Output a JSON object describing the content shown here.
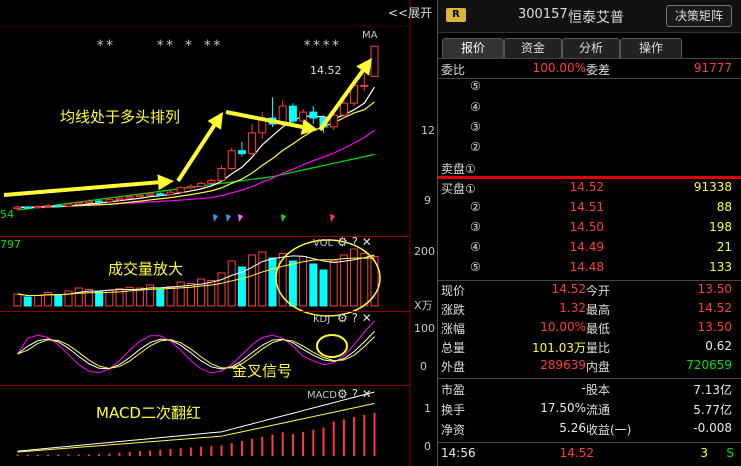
{
  "expand_button": "<<展开",
  "chart": {
    "ma_tag": "MA",
    "price_marker": "14.52",
    "stars": [
      "**",
      "** * **",
      "****"
    ],
    "y_main": [
      "12",
      "9"
    ],
    "y_vol": [
      "200",
      "X万"
    ],
    "y_kdj": [
      "100",
      "0"
    ],
    "y_macd": [
      "1",
      "0"
    ],
    "vol_tag": "VOL",
    "kdj_tag": "KDJ",
    "macd_tag": "MACD",
    "vol_left_num": "797",
    "left_num": "54",
    "annotations": {
      "ma_bull": "均线处于多头排列",
      "volume_up": "成交量放大",
      "golden_cross": "金叉信号",
      "macd_red": "MACD二次翻红"
    },
    "colors": {
      "up": "#ff3c3c",
      "down": "#00ffff",
      "ma5": "#ffffff",
      "ma10": "#ffff33",
      "ma20": "#ff00ff",
      "ma60": "#00e000",
      "arrow": "#ffff33"
    }
  },
  "chart_data": {
    "type": "candlestick",
    "candles": [
      {
        "o": 9.05,
        "c": 9.1,
        "h": 9.15,
        "l": 9.0
      },
      {
        "o": 9.1,
        "c": 9.08,
        "h": 9.14,
        "l": 9.03
      },
      {
        "o": 9.08,
        "c": 9.12,
        "h": 9.16,
        "l": 9.04
      },
      {
        "o": 9.12,
        "c": 9.15,
        "h": 9.2,
        "l": 9.08
      },
      {
        "o": 9.15,
        "c": 9.13,
        "h": 9.19,
        "l": 9.1
      },
      {
        "o": 9.13,
        "c": 9.2,
        "h": 9.24,
        "l": 9.1
      },
      {
        "o": 9.2,
        "c": 9.25,
        "h": 9.3,
        "l": 9.16
      },
      {
        "o": 9.25,
        "c": 9.3,
        "h": 9.36,
        "l": 9.22
      },
      {
        "o": 9.3,
        "c": 9.28,
        "h": 9.35,
        "l": 9.24
      },
      {
        "o": 9.28,
        "c": 9.35,
        "h": 9.4,
        "l": 9.25
      },
      {
        "o": 9.35,
        "c": 9.4,
        "h": 9.45,
        "l": 9.3
      },
      {
        "o": 9.4,
        "c": 9.45,
        "h": 9.5,
        "l": 9.36
      },
      {
        "o": 9.45,
        "c": 9.5,
        "h": 9.56,
        "l": 9.4
      },
      {
        "o": 9.5,
        "c": 9.55,
        "h": 9.62,
        "l": 9.46
      },
      {
        "o": 9.55,
        "c": 9.52,
        "h": 9.6,
        "l": 9.48
      },
      {
        "o": 9.52,
        "c": 9.6,
        "h": 9.66,
        "l": 9.5
      },
      {
        "o": 9.6,
        "c": 9.75,
        "h": 9.8,
        "l": 9.56
      },
      {
        "o": 9.75,
        "c": 9.8,
        "h": 9.88,
        "l": 9.7
      },
      {
        "o": 9.8,
        "c": 9.9,
        "h": 9.95,
        "l": 9.76
      },
      {
        "o": 9.9,
        "c": 10.0,
        "h": 10.05,
        "l": 9.86
      },
      {
        "o": 10.0,
        "c": 10.4,
        "h": 10.5,
        "l": 9.96
      },
      {
        "o": 10.4,
        "c": 11.0,
        "h": 11.1,
        "l": 10.35
      },
      {
        "o": 11.0,
        "c": 10.9,
        "h": 11.3,
        "l": 10.8
      },
      {
        "o": 10.9,
        "c": 11.6,
        "h": 11.9,
        "l": 10.85
      },
      {
        "o": 11.6,
        "c": 12.1,
        "h": 12.3,
        "l": 11.4
      },
      {
        "o": 12.1,
        "c": 11.9,
        "h": 12.8,
        "l": 11.8
      },
      {
        "o": 11.9,
        "c": 12.5,
        "h": 12.7,
        "l": 11.8
      },
      {
        "o": 12.5,
        "c": 12.0,
        "h": 12.6,
        "l": 11.9
      },
      {
        "o": 12.0,
        "c": 12.3,
        "h": 12.4,
        "l": 11.85
      },
      {
        "o": 12.3,
        "c": 12.1,
        "h": 12.5,
        "l": 11.9
      },
      {
        "o": 12.1,
        "c": 11.8,
        "h": 12.2,
        "l": 11.6
      },
      {
        "o": 11.8,
        "c": 12.2,
        "h": 12.35,
        "l": 11.7
      },
      {
        "o": 12.2,
        "c": 12.6,
        "h": 12.8,
        "l": 12.1
      },
      {
        "o": 12.6,
        "c": 13.2,
        "h": 13.4,
        "l": 12.5
      },
      {
        "o": 13.2,
        "c": 13.2,
        "h": 13.6,
        "l": 13.0
      },
      {
        "o": 13.5,
        "c": 14.52,
        "h": 14.52,
        "l": 13.5
      }
    ],
    "volume": [
      40,
      30,
      35,
      45,
      38,
      50,
      60,
      55,
      48,
      52,
      58,
      62,
      60,
      70,
      55,
      65,
      80,
      75,
      90,
      85,
      110,
      150,
      130,
      170,
      180,
      160,
      175,
      150,
      165,
      140,
      120,
      150,
      170,
      190,
      175,
      165
    ],
    "ylim_price": [
      8.8,
      15.2
    ]
  },
  "panel": {
    "badge": "R",
    "code": "300157",
    "name": "恒泰艾普",
    "decision_button": "决策矩阵",
    "tabs": [
      "报价",
      "资金",
      "分析",
      "操作"
    ],
    "weibi_label": "委比",
    "weibi_value": "100.00%",
    "weicha_label": "委差",
    "weicha_value": "91777",
    "sell_levels": [
      "⑤",
      "④",
      "③",
      "②",
      "卖盘①"
    ],
    "buy": [
      {
        "label": "买盘①",
        "price": "14.52",
        "vol": "91338"
      },
      {
        "label": "②",
        "price": "14.51",
        "vol": "88"
      },
      {
        "label": "③",
        "price": "14.50",
        "vol": "198"
      },
      {
        "label": "④",
        "price": "14.49",
        "vol": "21"
      },
      {
        "label": "⑤",
        "price": "14.48",
        "vol": "133"
      }
    ],
    "stats": [
      {
        "l1": "现价",
        "v1": "14.52",
        "c1": "red",
        "l2": "今开",
        "v2": "13.50",
        "c2": "red"
      },
      {
        "l1": "涨跌",
        "v1": "1.32",
        "c1": "red",
        "l2": "最高",
        "v2": "14.52",
        "c2": "red"
      },
      {
        "l1": "涨幅",
        "v1": "10.00%",
        "c1": "red",
        "l2": "最低",
        "v2": "13.50",
        "c2": "red"
      },
      {
        "l1": "总量",
        "v1": "101.03万",
        "c1": "yellow",
        "l2": "量比",
        "v2": "0.62",
        "c2": "white"
      },
      {
        "l1": "外盘",
        "v1": "289639",
        "c1": "red",
        "l2": "内盘",
        "v2": "720659",
        "c2": "green"
      }
    ],
    "fin": [
      {
        "l1": "市盈",
        "v1": "-",
        "l2": "股本",
        "v2": "7.13亿"
      },
      {
        "l1": "换手",
        "v1": "17.50%",
        "l2": "流通",
        "v2": "5.77亿"
      },
      {
        "l1": "净资",
        "v1": "5.26",
        "l2": "收益(一)",
        "v2": "-0.008"
      }
    ],
    "tick": {
      "time": "14:56",
      "price": "14.52",
      "vol": "3",
      "side": "S"
    }
  }
}
